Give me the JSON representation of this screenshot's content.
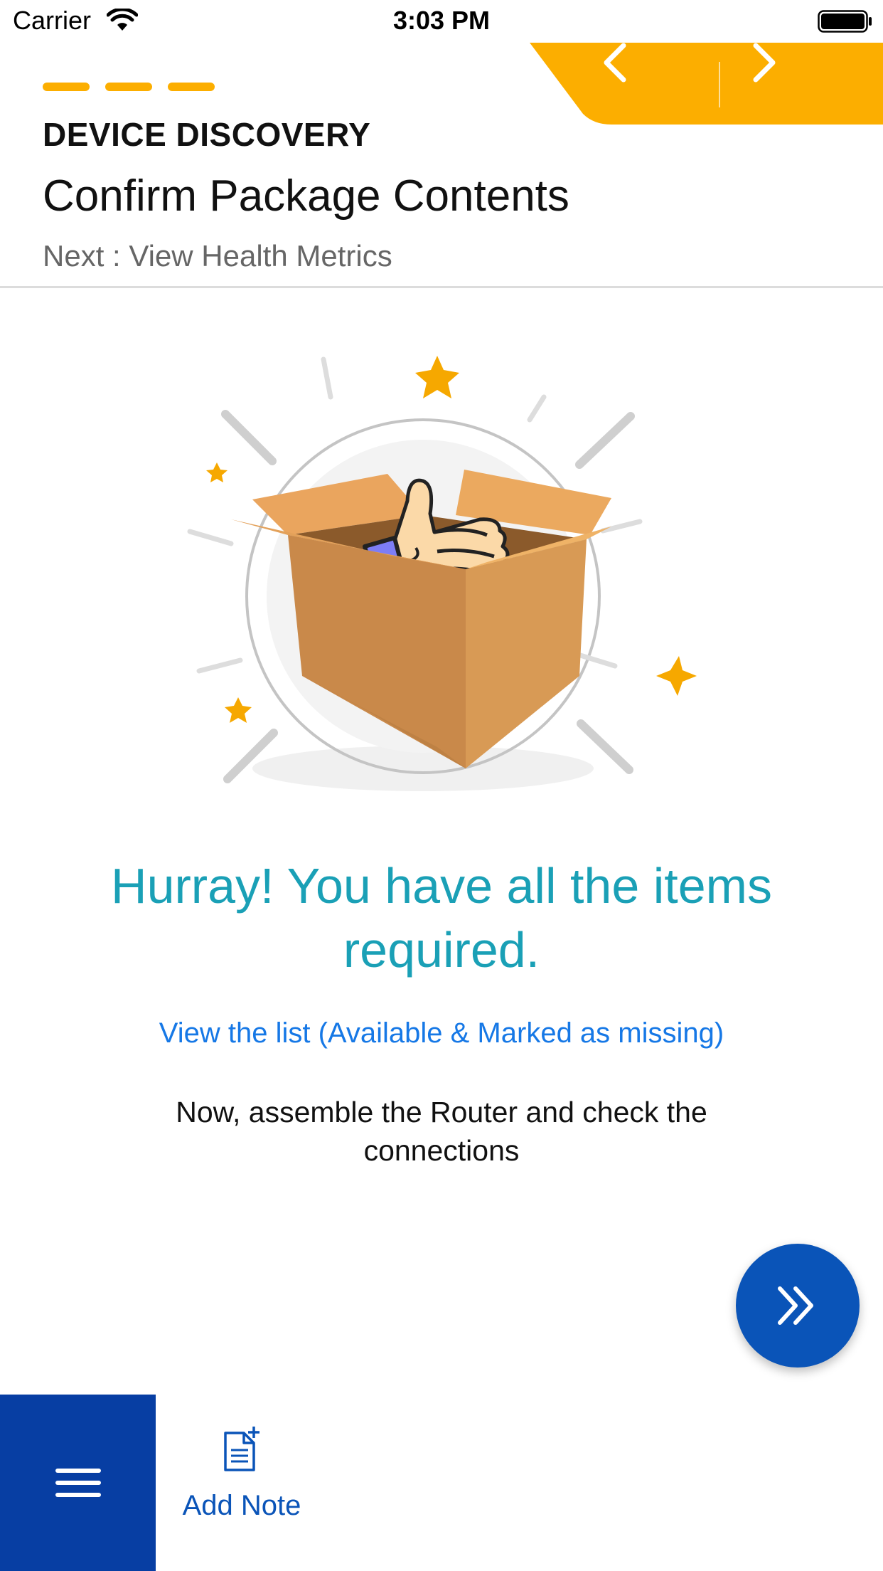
{
  "status_bar": {
    "carrier": "Carrier",
    "time": "3:03 PM",
    "icons": [
      "wifi-icon",
      "battery-icon"
    ]
  },
  "navigation": {
    "prev_icon": "chevron-left-icon",
    "next_icon": "chevron-right-icon",
    "accent_color": "#fcae00",
    "steps_shown": 3
  },
  "header": {
    "kicker": "DEVICE DISCOVERY",
    "title": "Confirm Package Contents",
    "next_step": "Next : View Health Metrics"
  },
  "illustration": {
    "icon": "open-box-thumbs-up-illustration"
  },
  "content": {
    "success_message": "Hurray! You have all the items required.",
    "list_link": "View the list (Available & Marked as missing)",
    "instruction": "Now, assemble the Router and check the connections"
  },
  "actions": {
    "proceed_icon": "double-chevron-right-icon",
    "menu_icon": "hamburger-menu-icon",
    "add_note_icon": "add-note-icon",
    "add_note_label": "Add Note"
  },
  "colors": {
    "primary_blue": "#0a54b8",
    "menu_blue": "#073ea3",
    "success_teal": "#1aa0b6",
    "link_blue": "#1678e6"
  }
}
